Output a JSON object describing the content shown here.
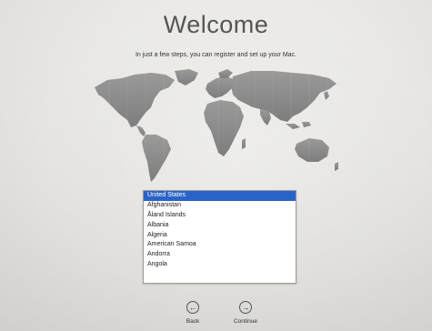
{
  "welcome": {
    "title": "Welcome",
    "subtitle": "In just a few steps, you can register and set up your Mac."
  },
  "countries": [
    "United States",
    "Afghanistan",
    "Åland Islands",
    "Albania",
    "Algeria",
    "American Samoa",
    "Andorra",
    "Angola"
  ],
  "selected_index": 0,
  "nav": {
    "back_label": "Back",
    "continue_label": "Continue",
    "back_icon": "arrow-left-circle-icon",
    "continue_icon": "arrow-right-circle-icon"
  },
  "colors": {
    "selection": "#2a63c8",
    "map": "#8c8c8c"
  }
}
